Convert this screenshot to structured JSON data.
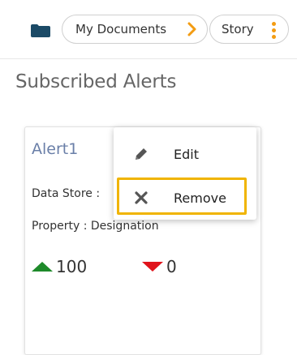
{
  "breadcrumb": {
    "items": [
      {
        "label": "My Documents"
      },
      {
        "label": "Story"
      }
    ]
  },
  "page": {
    "title": "Subscribed Alerts"
  },
  "alert_card": {
    "name": "Alert1",
    "data_store_label": "Data Store :",
    "property_text": "Property : Designation",
    "increase_value": "100",
    "decrease_value": "0"
  },
  "context_menu": {
    "items": [
      {
        "label": "Edit",
        "icon": "pencil-icon"
      },
      {
        "label": "Remove",
        "icon": "close-icon"
      }
    ]
  },
  "colors": {
    "accent_orange": "#f39c12",
    "highlight_yellow": "#f0b400",
    "up_green": "#1e8a2a",
    "down_red": "#e0131b",
    "alert_title": "#6a7fa8"
  }
}
